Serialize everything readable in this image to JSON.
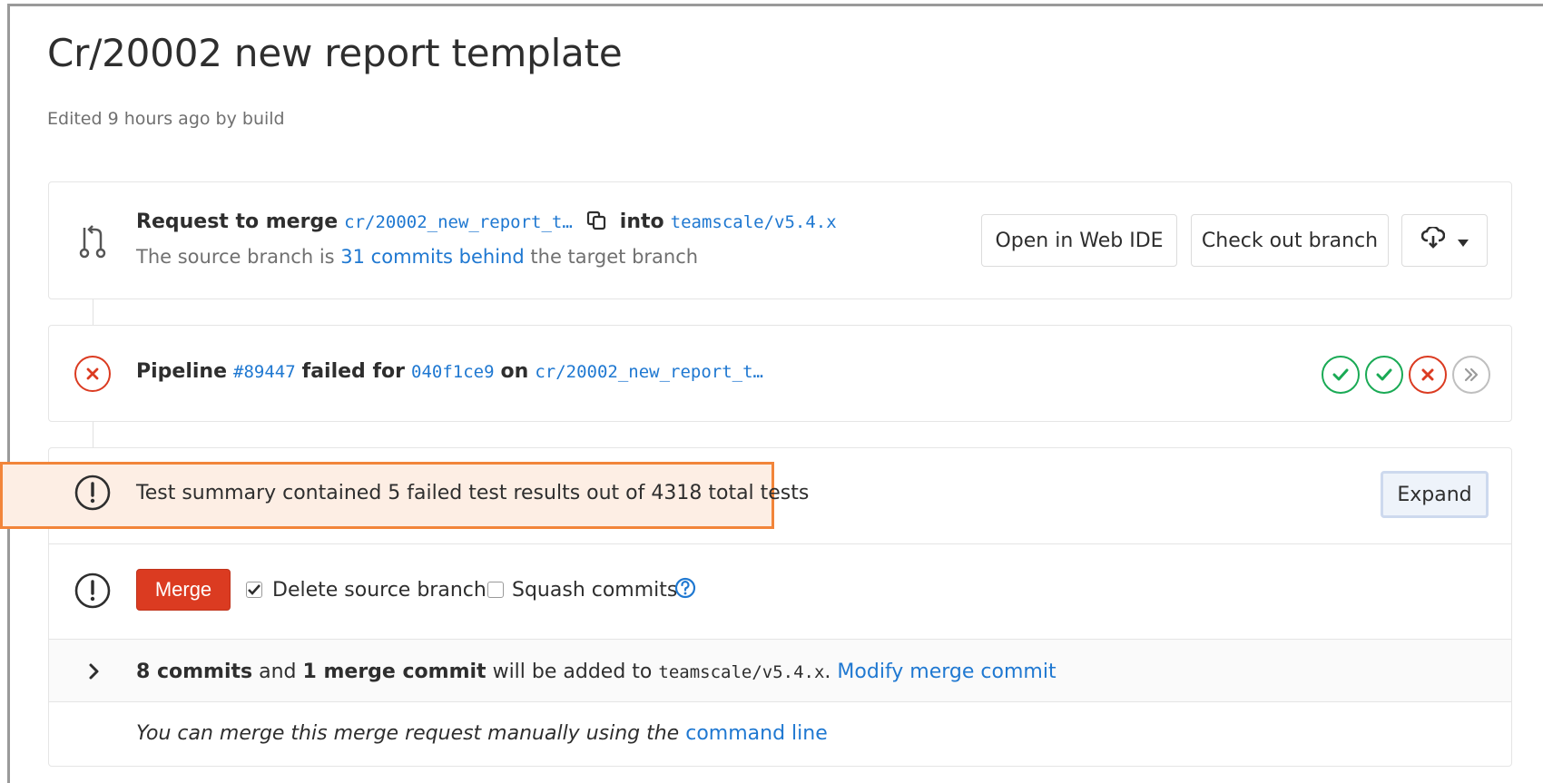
{
  "page": {
    "title": "Cr/20002 new report template",
    "edited": "Edited 9 hours ago by build"
  },
  "merge_request": {
    "request_prefix": "Request to merge",
    "source_branch": "cr/20002_new_report_t…",
    "into": "into",
    "target_branch": "teamscale/v5.4.x",
    "sub_prefix": "The source branch is",
    "behind_link": "31 commits behind",
    "sub_suffix": "the target branch",
    "buttons": {
      "web_ide": "Open in Web IDE",
      "checkout": "Check out branch"
    }
  },
  "pipeline": {
    "label": "Pipeline",
    "id": "#89447",
    "status_text": "failed for",
    "commit": "040f1ce9",
    "on": "on",
    "branch": "cr/20002_new_report_t…",
    "stages": [
      "passed",
      "passed",
      "failed",
      "skipped"
    ]
  },
  "test_summary": {
    "text": "Test summary contained 5 failed test results out of 4318 total tests",
    "expand_label": "Expand"
  },
  "merge": {
    "button_label": "Merge",
    "delete_source_label": "Delete source branch",
    "delete_source_checked": true,
    "squash_label": "Squash commits",
    "squash_checked": false
  },
  "commits": {
    "count": "8 commits",
    "and": "and",
    "merge_commit": "1 merge commit",
    "will_be_added": "will be added to",
    "target": "teamscale/v5.4.x",
    "period": ".",
    "modify_link": "Modify merge commit"
  },
  "manual_merge": {
    "text": "You can merge this merge request manually using the",
    "link": "command line"
  },
  "colors": {
    "link": "#1f78d1",
    "merge_red": "#db3b21",
    "success_green": "#1aaa55",
    "highlight_orange": "#f2853a"
  }
}
